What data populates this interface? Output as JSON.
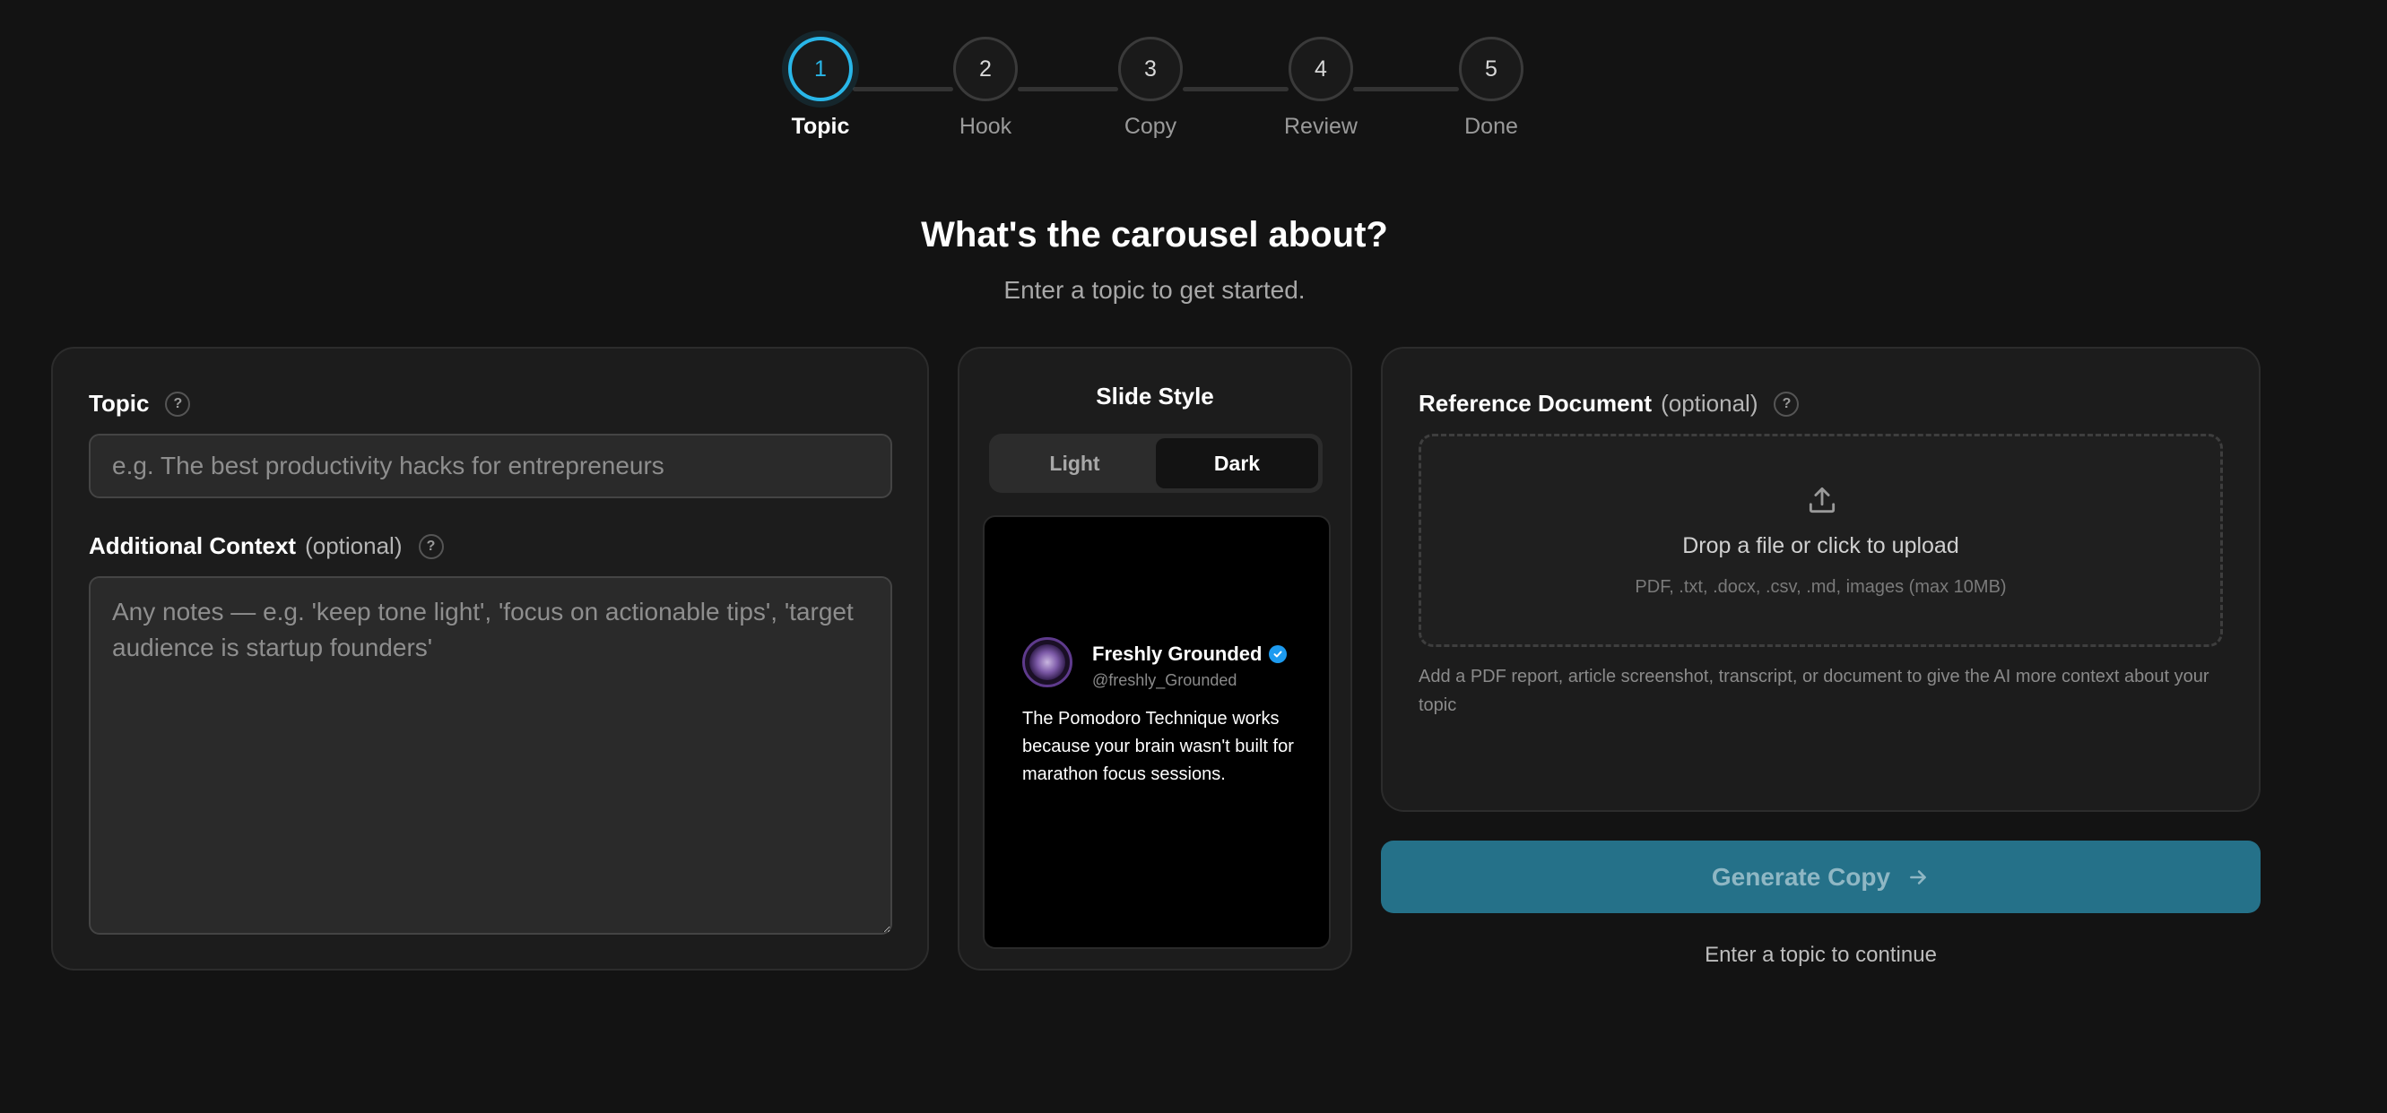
{
  "stepper": {
    "steps": [
      {
        "number": "1",
        "label": "Topic",
        "active": true
      },
      {
        "number": "2",
        "label": "Hook",
        "active": false
      },
      {
        "number": "3",
        "label": "Copy",
        "active": false
      },
      {
        "number": "4",
        "label": "Review",
        "active": false
      },
      {
        "number": "5",
        "label": "Done",
        "active": false
      }
    ]
  },
  "header": {
    "title": "What's the carousel about?",
    "subtitle": "Enter a topic to get started."
  },
  "topic_panel": {
    "topic_label": "Topic",
    "topic_help": "?",
    "topic_placeholder": "e.g. The best productivity hacks for entrepreneurs",
    "context_label": "Additional Context",
    "context_optional": "(optional)",
    "context_help": "?",
    "context_placeholder": "Any notes — e.g. 'keep tone light', 'focus on actionable tips', 'target audience is startup founders'"
  },
  "slide_style": {
    "title": "Slide Style",
    "options": [
      "Light",
      "Dark"
    ],
    "selected": "Dark",
    "preview": {
      "name": "Freshly Grounded",
      "handle": "@freshly_Grounded",
      "text": "The Pomodoro Technique works because your brain wasn't built for marathon focus sessions."
    }
  },
  "reference_panel": {
    "label": "Reference Document",
    "optional": "(optional)",
    "help": "?",
    "dropzone_title": "Drop a file or click to upload",
    "dropzone_formats": "PDF, .txt, .docx, .csv, .md, images (max 10MB)",
    "description": "Add a PDF report, article screenshot, transcript, or document to give the AI more context about your topic"
  },
  "actions": {
    "generate_label": "Generate Copy",
    "hint": "Enter a topic to continue"
  },
  "colors": {
    "accent": "#29b6e8",
    "button_bg": "#257189",
    "page_bg": "#131313",
    "verified": "#1d9bf0"
  }
}
